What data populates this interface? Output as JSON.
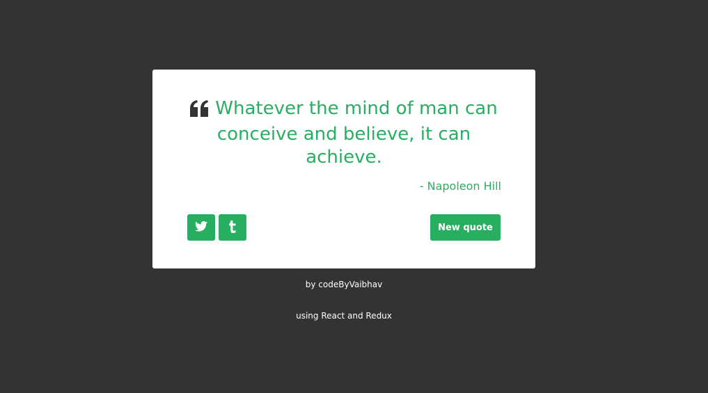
{
  "quote": {
    "text": "Whatever the mind of man can conceive and believe, it can achieve.",
    "author": "- Napoleon Hill"
  },
  "actions": {
    "new_quote_label": "New quote",
    "twitter_icon": "twitter-icon",
    "tumblr_icon": "tumblr-icon"
  },
  "footer": {
    "credit": "by codeByVaibhav",
    "tech": "using React and Redux"
  },
  "colors": {
    "background": "#333333",
    "card": "#ffffff",
    "accent": "#27ae60",
    "quote_icon": "#333333"
  }
}
